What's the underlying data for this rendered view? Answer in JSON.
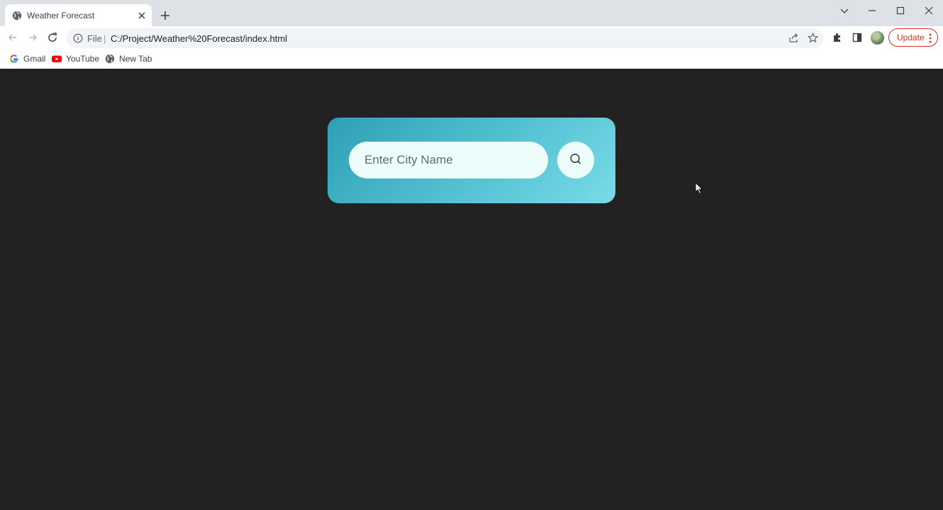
{
  "browser": {
    "tab": {
      "title": "Weather Forecast"
    },
    "address": {
      "scheme": "File",
      "separator": "|",
      "url": "C:/Project/Weather%20Forecast/index.html"
    },
    "update_label": "Update",
    "bookmarks": [
      {
        "label": "Gmail",
        "icon": "google-icon"
      },
      {
        "label": "YouTube",
        "icon": "youtube-icon"
      },
      {
        "label": "New Tab",
        "icon": "globe-icon"
      }
    ]
  },
  "app": {
    "search": {
      "placeholder": "Enter City Name",
      "value": ""
    }
  },
  "colors": {
    "page_bg": "#222222",
    "card_gradient_start": "#2f9fb4",
    "card_gradient_end": "#79dbe7",
    "input_bg": "#edfdfb",
    "update_accent": "#d93025"
  }
}
